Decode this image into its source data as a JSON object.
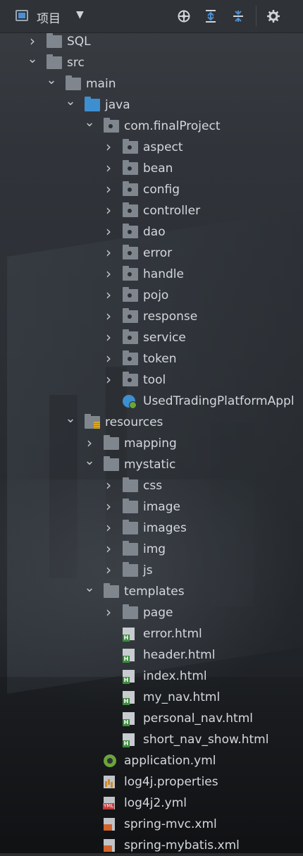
{
  "toolbar": {
    "title": "项目",
    "icons": [
      "project-panel-icon",
      "chevron-down-icon",
      "locate-icon",
      "expand-all-icon",
      "collapse-all-icon",
      "gear-icon"
    ]
  },
  "tree": [
    {
      "label": "SQL",
      "depth": 0,
      "expanded": false,
      "icon": "folder"
    },
    {
      "label": "src",
      "depth": 0,
      "expanded": true,
      "icon": "folder"
    },
    {
      "label": "main",
      "depth": 1,
      "expanded": true,
      "icon": "folder"
    },
    {
      "label": "java",
      "depth": 2,
      "expanded": true,
      "icon": "source-folder"
    },
    {
      "label": "com.finalProject",
      "depth": 3,
      "expanded": true,
      "icon": "package"
    },
    {
      "label": "aspect",
      "depth": 4,
      "expanded": false,
      "icon": "package"
    },
    {
      "label": "bean",
      "depth": 4,
      "expanded": false,
      "icon": "package"
    },
    {
      "label": "config",
      "depth": 4,
      "expanded": false,
      "icon": "package"
    },
    {
      "label": "controller",
      "depth": 4,
      "expanded": false,
      "icon": "package"
    },
    {
      "label": "dao",
      "depth": 4,
      "expanded": false,
      "icon": "package"
    },
    {
      "label": "error",
      "depth": 4,
      "expanded": false,
      "icon": "package"
    },
    {
      "label": "handle",
      "depth": 4,
      "expanded": false,
      "icon": "package"
    },
    {
      "label": "pojo",
      "depth": 4,
      "expanded": false,
      "icon": "package"
    },
    {
      "label": "response",
      "depth": 4,
      "expanded": false,
      "icon": "package"
    },
    {
      "label": "service",
      "depth": 4,
      "expanded": false,
      "icon": "package"
    },
    {
      "label": "token",
      "depth": 4,
      "expanded": false,
      "icon": "package"
    },
    {
      "label": "tool",
      "depth": 4,
      "expanded": false,
      "icon": "package"
    },
    {
      "label": "UsedTradingPlatformAppl",
      "depth": 4,
      "expanded": null,
      "icon": "spring-class"
    },
    {
      "label": "resources",
      "depth": 2,
      "expanded": true,
      "icon": "resources-folder"
    },
    {
      "label": "mapping",
      "depth": 3,
      "expanded": false,
      "icon": "folder"
    },
    {
      "label": "mystatic",
      "depth": 3,
      "expanded": true,
      "icon": "folder"
    },
    {
      "label": "css",
      "depth": 4,
      "expanded": false,
      "icon": "folder"
    },
    {
      "label": "image",
      "depth": 4,
      "expanded": false,
      "icon": "folder"
    },
    {
      "label": "images",
      "depth": 4,
      "expanded": false,
      "icon": "folder"
    },
    {
      "label": "img",
      "depth": 4,
      "expanded": false,
      "icon": "folder"
    },
    {
      "label": "js",
      "depth": 4,
      "expanded": false,
      "icon": "folder"
    },
    {
      "label": "templates",
      "depth": 3,
      "expanded": true,
      "icon": "folder"
    },
    {
      "label": "page",
      "depth": 4,
      "expanded": false,
      "icon": "folder"
    },
    {
      "label": "error.html",
      "depth": 4,
      "expanded": null,
      "icon": "html-file"
    },
    {
      "label": "header.html",
      "depth": 4,
      "expanded": null,
      "icon": "html-file"
    },
    {
      "label": "index.html",
      "depth": 4,
      "expanded": null,
      "icon": "html-file"
    },
    {
      "label": "my_nav.html",
      "depth": 4,
      "expanded": null,
      "icon": "html-file"
    },
    {
      "label": "personal_nav.html",
      "depth": 4,
      "expanded": null,
      "icon": "html-file"
    },
    {
      "label": "short_nav_show.html",
      "depth": 4,
      "expanded": null,
      "icon": "html-file"
    },
    {
      "label": "application.yml",
      "depth": 3,
      "expanded": null,
      "icon": "spring-config-file"
    },
    {
      "label": "log4j.properties",
      "depth": 3,
      "expanded": null,
      "icon": "properties-file"
    },
    {
      "label": "log4j2.yml",
      "depth": 3,
      "expanded": null,
      "icon": "yml-file"
    },
    {
      "label": "spring-mvc.xml",
      "depth": 3,
      "expanded": null,
      "icon": "spring-xml-file"
    },
    {
      "label": "spring-mybatis.xml",
      "depth": 3,
      "expanded": null,
      "icon": "xml-file"
    }
  ]
}
